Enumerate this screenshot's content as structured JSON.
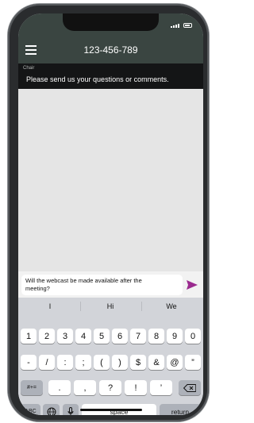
{
  "header": {
    "title": "123-456-789"
  },
  "chat": {
    "sender": "Chair",
    "message": "Please send us your questions or comments."
  },
  "compose": {
    "text_line1": "Will the webcast be made available after the",
    "text_line2": "meeting?"
  },
  "keyboard": {
    "suggestions": [
      "I",
      "Hi",
      "We"
    ],
    "digits": [
      "1",
      "2",
      "3",
      "4",
      "5",
      "6",
      "7",
      "8",
      "9",
      "0"
    ],
    "symbols": [
      "-",
      "/",
      ":",
      ";",
      "(",
      ")",
      "$",
      "&",
      "@",
      "”"
    ],
    "mode_key": "#+=",
    "punct": [
      ".",
      ",",
      "?",
      "!",
      "’"
    ],
    "abc_key": "ABC",
    "space_key": "space",
    "return_key": "return"
  },
  "colors": {
    "header_bg": "#3a4541",
    "send_accent": "#9b2a8f"
  }
}
